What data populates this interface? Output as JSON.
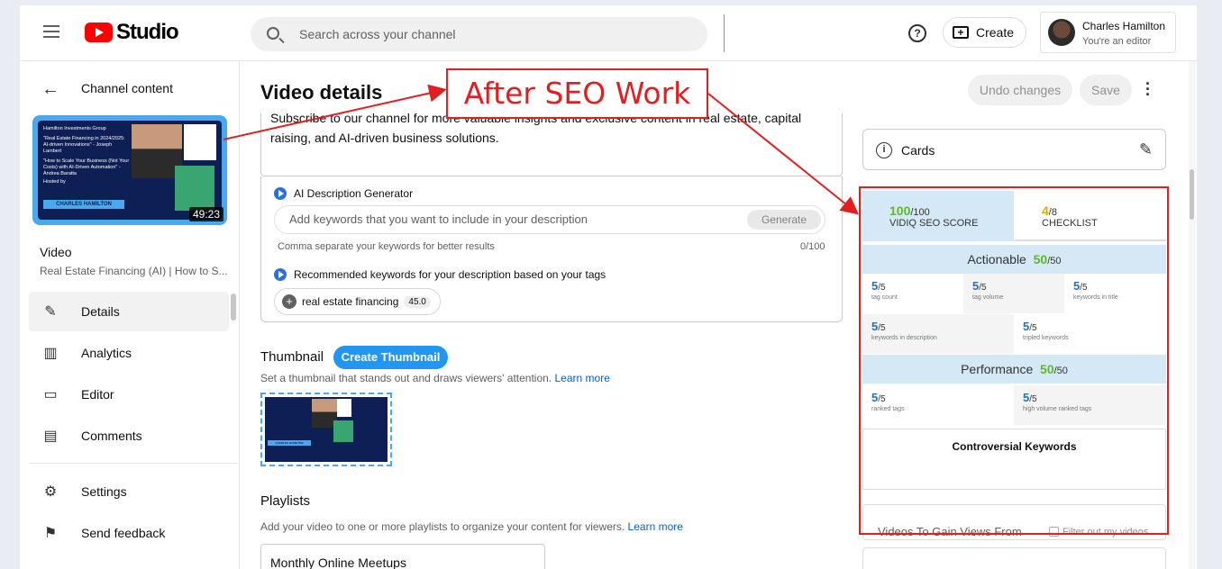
{
  "header": {
    "logo_text": "Studio",
    "search_placeholder": "Search across your channel",
    "create_label": "Create",
    "account_name": "Charles Hamilton",
    "account_role": "You're an editor"
  },
  "sidebar": {
    "back_label": "Channel content",
    "thumbnail": {
      "group": "Hamilton Investments Group",
      "text1": "\"Real Estate Financing in 2024/2025: AI-driven Innovations\" - Joseph Lambert",
      "text2": "\"How to Scale Your Business (Not Your Costs) with AI-Driven Automation\" - Andrea Baratta",
      "hosted_by": "Hosted by",
      "host": "CHARLES HAMILTON",
      "duration": "49:23"
    },
    "video_label": "Video",
    "video_title": "Real Estate Financing (AI) | How to S...",
    "items": [
      {
        "label": "Details",
        "icon": "pencil-icon"
      },
      {
        "label": "Analytics",
        "icon": "analytics-icon"
      },
      {
        "label": "Editor",
        "icon": "editor-icon"
      },
      {
        "label": "Comments",
        "icon": "comments-icon"
      },
      {
        "label": "Settings",
        "icon": "gear-icon"
      },
      {
        "label": "Send feedback",
        "icon": "feedback-icon"
      }
    ]
  },
  "main": {
    "title": "Video details",
    "undo_label": "Undo changes",
    "save_label": "Save",
    "description_text": "Subscribe to our channel for more valuable insights and exclusive content in real estate, capital raising, and AI-driven business solutions.",
    "ai": {
      "generator_label": "AI Description Generator",
      "keywords_placeholder": "Add keywords that you want to include in your description",
      "generate_label": "Generate",
      "hint": "Comma separate your keywords for better results",
      "counter": "0/100",
      "recommended_label": "Recommended keywords for your description based on your tags",
      "chip_label": "real estate financing",
      "chip_score": "45.0"
    },
    "thumbnail_heading": "Thumbnail",
    "create_thumbnail_label": "Create Thumbnail",
    "thumbnail_desc": "Set a thumbnail that stands out and draws viewers' attention.",
    "learn_more": "Learn more",
    "playlists_heading": "Playlists",
    "playlists_desc": "Add your video to one or more playlists to organize your content for viewers.",
    "playlist_value": "Monthly Online Meetups"
  },
  "right_panel": {
    "cards_label": "Cards",
    "seo_score": "100",
    "seo_score_max": "/100",
    "seo_label": "VIDIQ SEO SCORE",
    "checklist_score": "4",
    "checklist_max": "/8",
    "checklist_label": "CHECKLIST",
    "actionable_label": "Actionable",
    "actionable_score": "50",
    "actionable_max": "/50",
    "actionable_items": [
      {
        "value": "5",
        "max": "/5",
        "label": "tag count"
      },
      {
        "value": "5",
        "max": "/5",
        "label": "tag volume"
      },
      {
        "value": "5",
        "max": "/5",
        "label": "keywords in title"
      },
      {
        "value": "5",
        "max": "/5",
        "label": "keywords in description"
      },
      {
        "value": "5",
        "max": "/5",
        "label": "tripled keywords"
      }
    ],
    "performance_label": "Performance",
    "performance_score": "50",
    "performance_max": "/50",
    "performance_items": [
      {
        "value": "5",
        "max": "/5",
        "label": "ranked tags"
      },
      {
        "value": "5",
        "max": "/5",
        "label": "high volume ranked tags"
      }
    ],
    "controversial_label": "Controversial Keywords",
    "gain_title": "Videos To Gain Views From",
    "filter_label": "Filter out my videos"
  },
  "annotation": {
    "label": "After SEO Work",
    "color": "#e02020"
  }
}
